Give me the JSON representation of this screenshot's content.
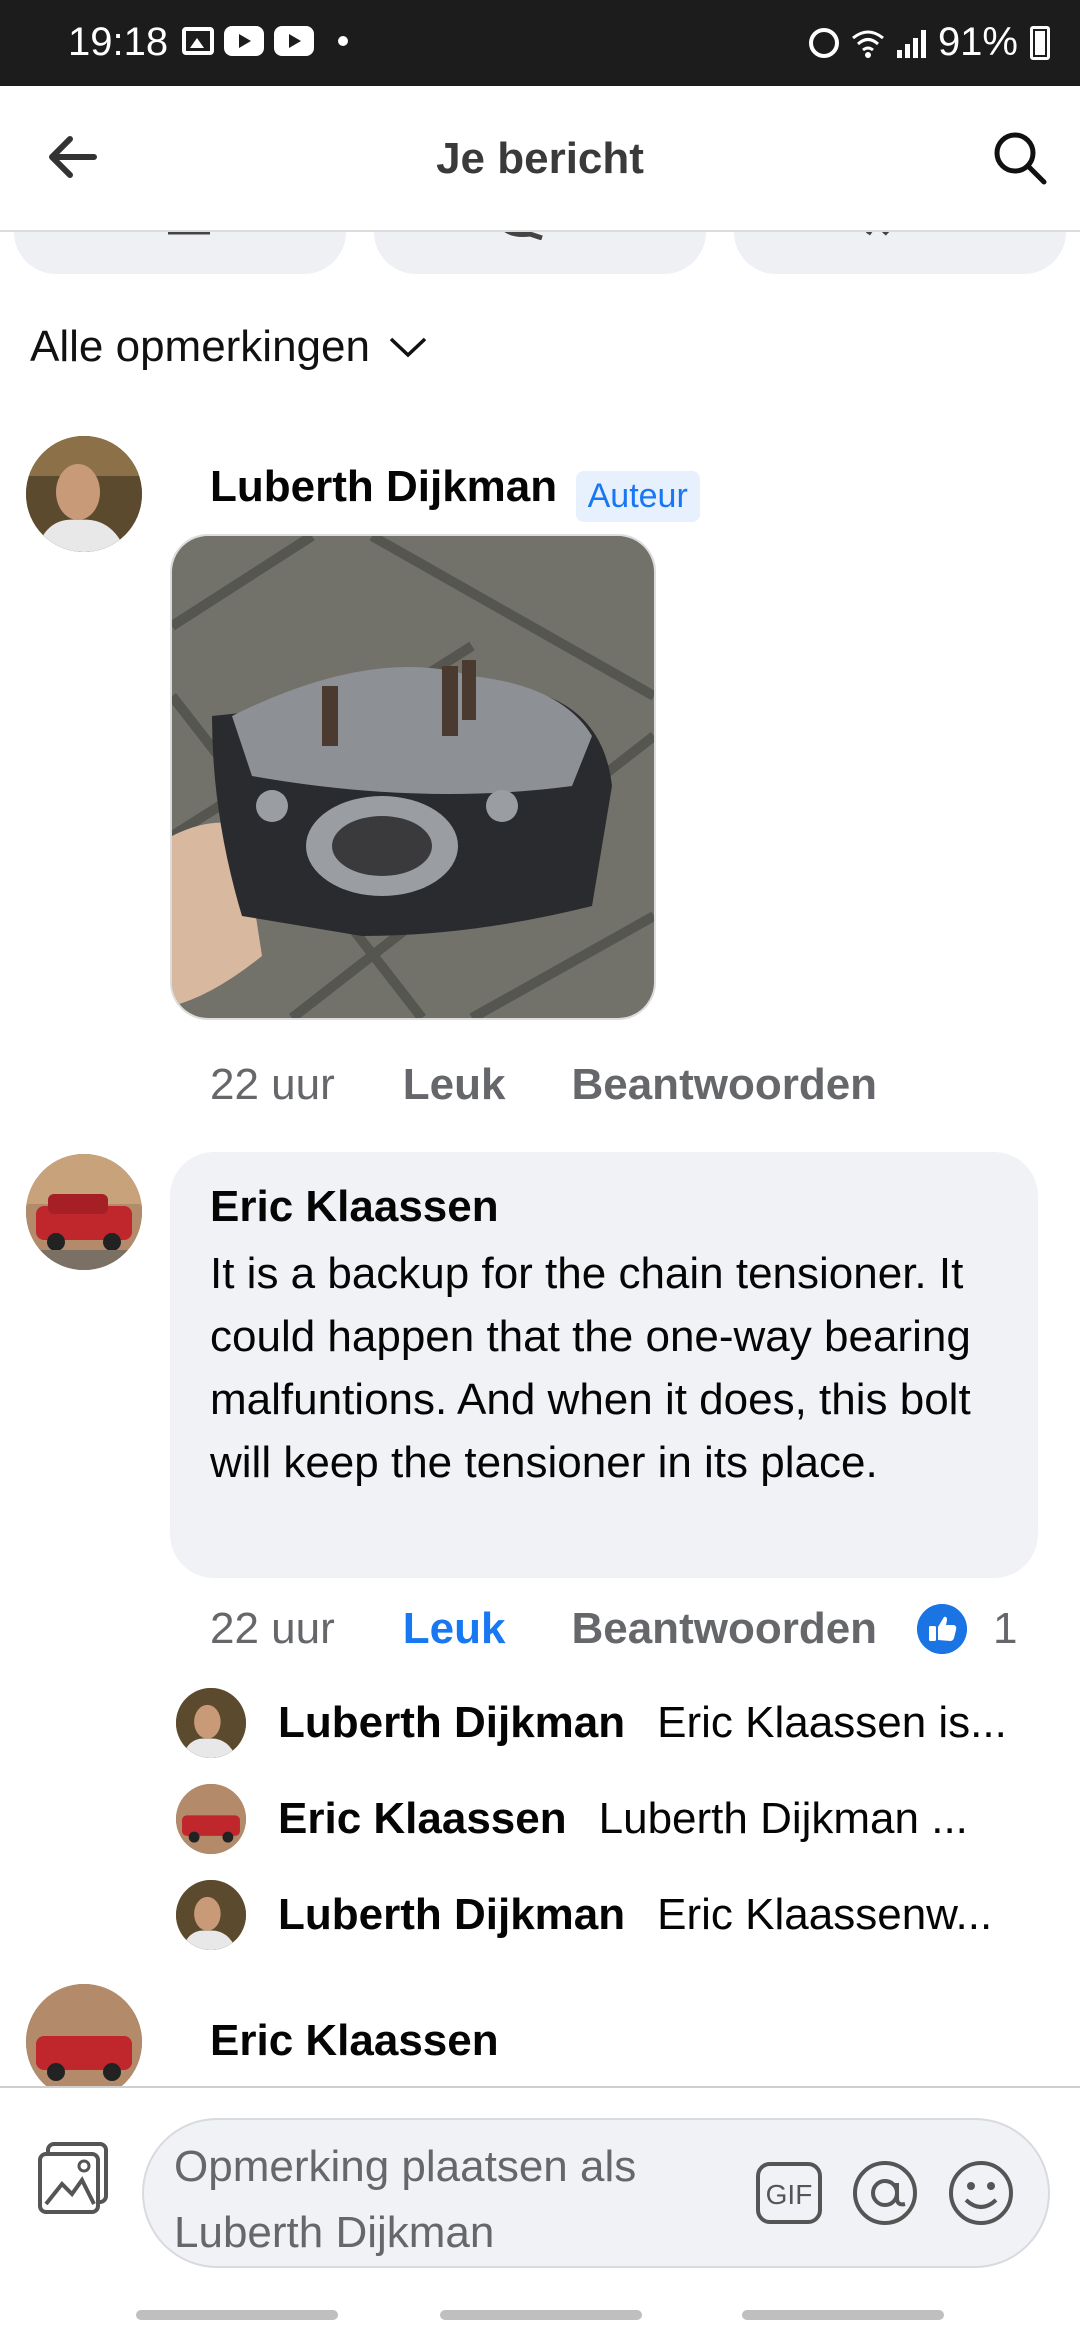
{
  "status_bar": {
    "time": "19:18",
    "battery": "91%"
  },
  "header": {
    "title": "Je bericht"
  },
  "filter": {
    "label": "Alle opmerkingen"
  },
  "post": {
    "author": "Luberth Dijkman",
    "author_badge": "Auteur",
    "time": "22 uur",
    "like_label": "Leuk",
    "reply_label": "Beantwoorden"
  },
  "comment": {
    "author": "Eric Klaassen",
    "text": "It is a backup for the chain tensioner. It could happen that the one-way bearing malfuntions. And when it does, this bolt will keep the tensioner in its place.",
    "time": "22 uur",
    "like_label": "Leuk",
    "reply_label": "Beantwoorden",
    "like_count": "1",
    "liked": true
  },
  "replies": [
    {
      "author": "Luberth Dijkman",
      "preview": "Eric Klaassen is..."
    },
    {
      "author": "Eric Klaassen",
      "preview": "Luberth Dijkman ..."
    },
    {
      "author": "Luberth Dijkman",
      "preview": "Eric Klaassenw..."
    }
  ],
  "next_comment": {
    "author": "Eric Klaassen"
  },
  "composer": {
    "placeholder": "Opmerking plaatsen als Luberth Dijkman"
  },
  "colors": {
    "accent": "#1877f2",
    "bubble": "#f0f2f5",
    "muted": "#65676b"
  }
}
